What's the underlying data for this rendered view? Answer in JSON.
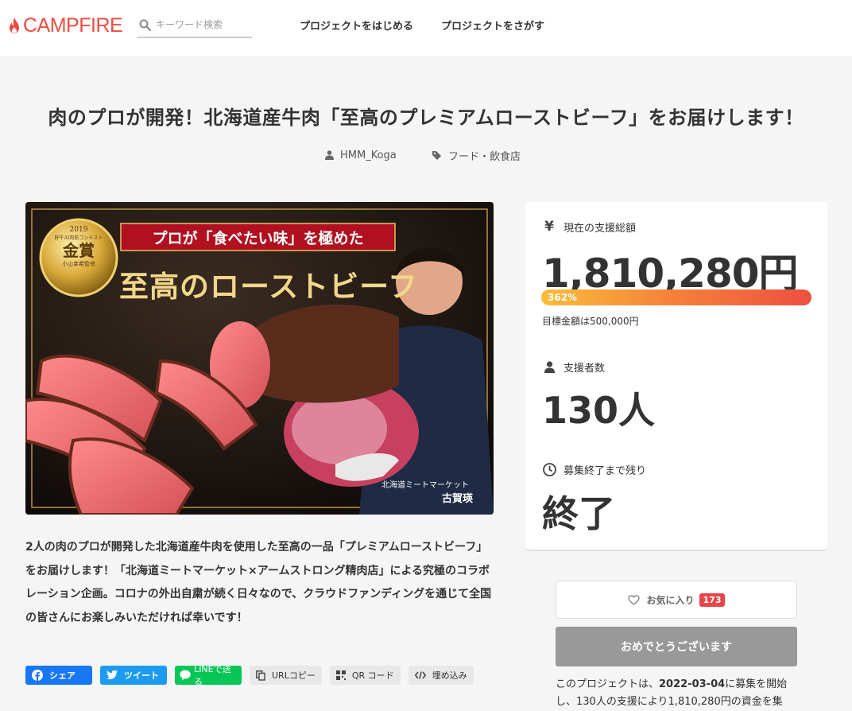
{
  "header": {
    "logo_text": "CAMPFIRE",
    "search_placeholder": "キーワード検索",
    "nav": [
      "プロジェクトをはじめる",
      "プロジェクトをさがす"
    ]
  },
  "project": {
    "title": "肉のプロが開発！北海道産牛肉「至高のプレミアムローストビーフ」をお届けします！",
    "owner": "HMM_Koga",
    "category": "フード・飲食店",
    "description": "2人の肉のプロが開発した北海道産牛肉を使用した至高の一品「プレミアムローストビーフ」をお届けします！「北海道ミートマーケット×アームストロング精肉店」による究極のコラボレーション企画。コロナの外出自粛が続く日々なので、クラウドファンディングを通じて全国の皆さんにお楽しみいただければ幸いです！"
  },
  "hero": {
    "badge_year": "2019",
    "badge_line1": "肝牛AI肉肪コンテスト",
    "badge_award": "金賞",
    "badge_line2": "小山幸希監修",
    "banner_text": "プロが「食べたい味」を極めた",
    "headline": "至高のローストビーフ",
    "caption_company": "北海道ミートマーケット",
    "caption_name": "古賀瑛"
  },
  "share": {
    "facebook": "シェア",
    "twitter": "ツイート",
    "line": "LINEで送る",
    "url_copy": "URLコピー",
    "qr": "QR コード",
    "embed": "埋め込み"
  },
  "stats": {
    "total_label": "現在の支援総額",
    "total_amount": "1,810,280円",
    "percent": "362%",
    "progress_ratio": 1.0,
    "goal_text": "目標金額は500,000円",
    "supporters_label": "支援者数",
    "supporters_value": "130人",
    "remaining_label": "募集終了まで残り",
    "remaining_value": "終了"
  },
  "actions": {
    "favorite_label": "お気に入り",
    "favorite_count": "173",
    "congrats_label": "おめでとうございます"
  },
  "footer_text": {
    "prefix": "このプロジェクトは、",
    "date": "2022-03-04",
    "suffix": "に募集を開始し、130人の支援により1,810,280円の資金を集"
  },
  "colors": {
    "brand": "#ec4c3f",
    "favorite_badge": "#e8454b",
    "progress_start": "#fbbd3a",
    "progress_end": "#ee5040"
  }
}
